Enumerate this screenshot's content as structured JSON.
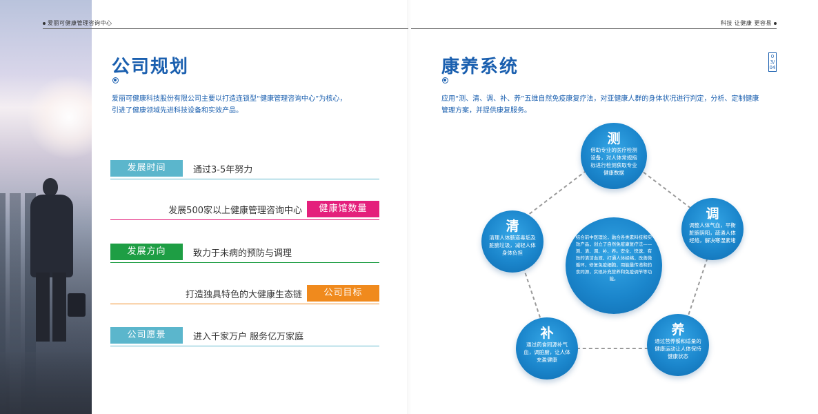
{
  "header": {
    "left": "爱丽可健康管理咨询中心",
    "right": "科技  让健康  更容易"
  },
  "page_number": "03/04",
  "left_page": {
    "title": "公司规划",
    "intro_line1": "爱丽可健康科技股份有限公司主要以打造连锁型“健康管理咨询中心”为核心，",
    "intro_line2": "引进了健康领域先进科技设备和实效产品。",
    "plan": [
      {
        "tag": "发展时间",
        "text": "通过3-5年努力",
        "color": "#5bb6cc",
        "side": "left"
      },
      {
        "tag": "健康馆数量",
        "text": "发展500家以上健康管理咨询中心",
        "color": "#e4207c",
        "side": "right"
      },
      {
        "tag": "发展方向",
        "text": "致力于未病的预防与调理",
        "color": "#1e9e44",
        "side": "left"
      },
      {
        "tag": "公司目标",
        "text": "打造独具特色的大健康生态链",
        "color": "#f08a1d",
        "side": "right"
      },
      {
        "tag": "公司愿景",
        "text": "进入千家万户   服务亿万家庭",
        "color": "#5bb6cc",
        "side": "left"
      }
    ]
  },
  "right_page": {
    "title": "康养系统",
    "intro_line1": "应用“测、清、调、补、养”五维自然免疫康复疗法，对亚健康人群的身体状况进行判定，分析、定制健康",
    "intro_line2": "管理方案，并提供康复服务。",
    "center": "结合前中医理论，融合各类素料技和实效产品，创立了自然免疫康复疗法——测、清、调、补、养。安全、快速、有效的清洁血液，打通人体经络，改善微循环，修复免疫细胞，用能量传递和药食同源，实现补充营养和免疫调节等功能。",
    "nodes": [
      {
        "char": "测",
        "text": "借助专业的医疗检测设备，对人体常规指标进行检测获取专业健康数据"
      },
      {
        "char": "调",
        "text": "调整人体气血，平衡脏腑阴阳，疏通人体经络，解决寒湿紊堵"
      },
      {
        "char": "养",
        "text": "通过营养餐和适量的健康运动让人体保持健康状态"
      },
      {
        "char": "补",
        "text": "通过药食同源补气血，调脏腑，让人体充盈健康"
      },
      {
        "char": "清",
        "text": "清理人体肠道毒垢及脏腑垃圾，减轻人体身体负担"
      }
    ]
  },
  "colors": {
    "title_blue": "#1a5faf",
    "circle_blue": "#1b86cc"
  }
}
